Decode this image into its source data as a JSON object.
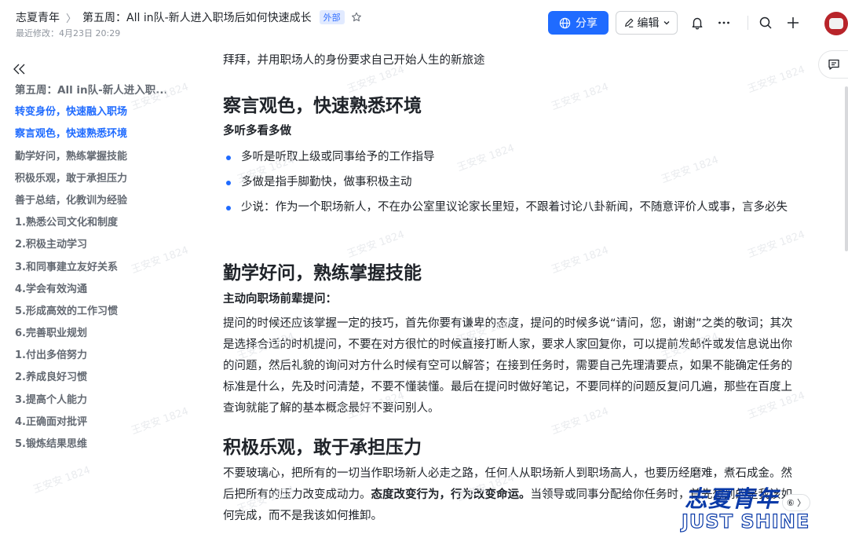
{
  "header": {
    "space_name": "志夏青年",
    "doc_title": "第五周：All in队-新人进入职场后如何快速成长",
    "external_tag": "外部",
    "last_modified": "最近修改：4月23日 20:29",
    "share_label": "分享",
    "edit_label": "编辑"
  },
  "toc": [
    {
      "label": "第五周：All in队-新人进入职...",
      "state": "root"
    },
    {
      "label": "转变身份，快速融入职场",
      "state": "active"
    },
    {
      "label": "察言观色，快速熟悉环境",
      "state": "active"
    },
    {
      "label": "勤学好问，熟练掌握技能",
      "state": ""
    },
    {
      "label": "积极乐观，敢于承担压力",
      "state": ""
    },
    {
      "label": "善于总结，化教训为经验",
      "state": ""
    },
    {
      "label": "1.熟悉公司文化和制度",
      "state": ""
    },
    {
      "label": "2.积极主动学习",
      "state": ""
    },
    {
      "label": "3.和同事建立友好关系",
      "state": ""
    },
    {
      "label": "4.学会有效沟通",
      "state": ""
    },
    {
      "label": "5.形成高效的工作习惯",
      "state": ""
    },
    {
      "label": "6.完善职业规划",
      "state": ""
    },
    {
      "label": "1.付出多倍努力",
      "state": ""
    },
    {
      "label": "2.养成良好习惯",
      "state": ""
    },
    {
      "label": "3.提高个人能力",
      "state": ""
    },
    {
      "label": "4.正确面对批评",
      "state": ""
    },
    {
      "label": "5.锻炼结果思维",
      "state": ""
    }
  ],
  "content": {
    "intro": "拜拜，并用职场人的身份要求自己开始人生的新旅途",
    "section1": {
      "heading": "察言观色，快速熟悉环境",
      "subhead": "多听多看多做",
      "bullets": [
        "多听是听取上级或同事给予的工作指导",
        "多做是指手脚勤快，做事积极主动",
        "少说：作为一个职场新人，不在办公室里议论家长里短，不跟着讨论八卦新闻，不随意评价人或事，言多必失"
      ]
    },
    "section2": {
      "heading": "勤学好问，熟练掌握技能",
      "subhead": "主动向职场前辈提问：",
      "paragraph": "提问的时候还应该掌握一定的技巧，首先你要有谦卑的态度，提问的时候多说“请问，您，谢谢”之类的敬词；其次是选择合适的时机提问，不要在对方很忙的时候直接打断人家，要求人家回复你，可以提前发邮件或发信息说出你的问题，然后礼貌的询问对方什么时候有空可以解答；在接到任务时，需要自己先理清要点，如果不能确定任务的标准是什么，先及时问清楚，不要不懂装懂。最后在提问时做好笔记，不要同样的问题反复问几遍，那些在百度上查询就能了解的基本概念最好不要问别人。"
    },
    "section3": {
      "heading": "积极乐观，敢于承担压力",
      "para_a": "不要玻璃心，把所有的一切当作职场新人必走之路，任何人从职场新人到职场高人，也要历经磨难，煮石成金。然后把所有的压力改变成动力。",
      "para_bold": "态度改变行为，行为改变命运。",
      "para_b": "当领导或同事分配给你任务时，首先想到的是我该如何完成，而不是我该如何推卸。"
    }
  },
  "watermark": "王安安 1824",
  "brand": {
    "cn": "志夏青年",
    "en": "JUST SHINE",
    "badge": "⑥ 〉"
  },
  "colors": {
    "accent": "#1f6bff",
    "brand_blue": "#0a3aa8",
    "text": "#1f2329",
    "muted": "#646a73"
  }
}
